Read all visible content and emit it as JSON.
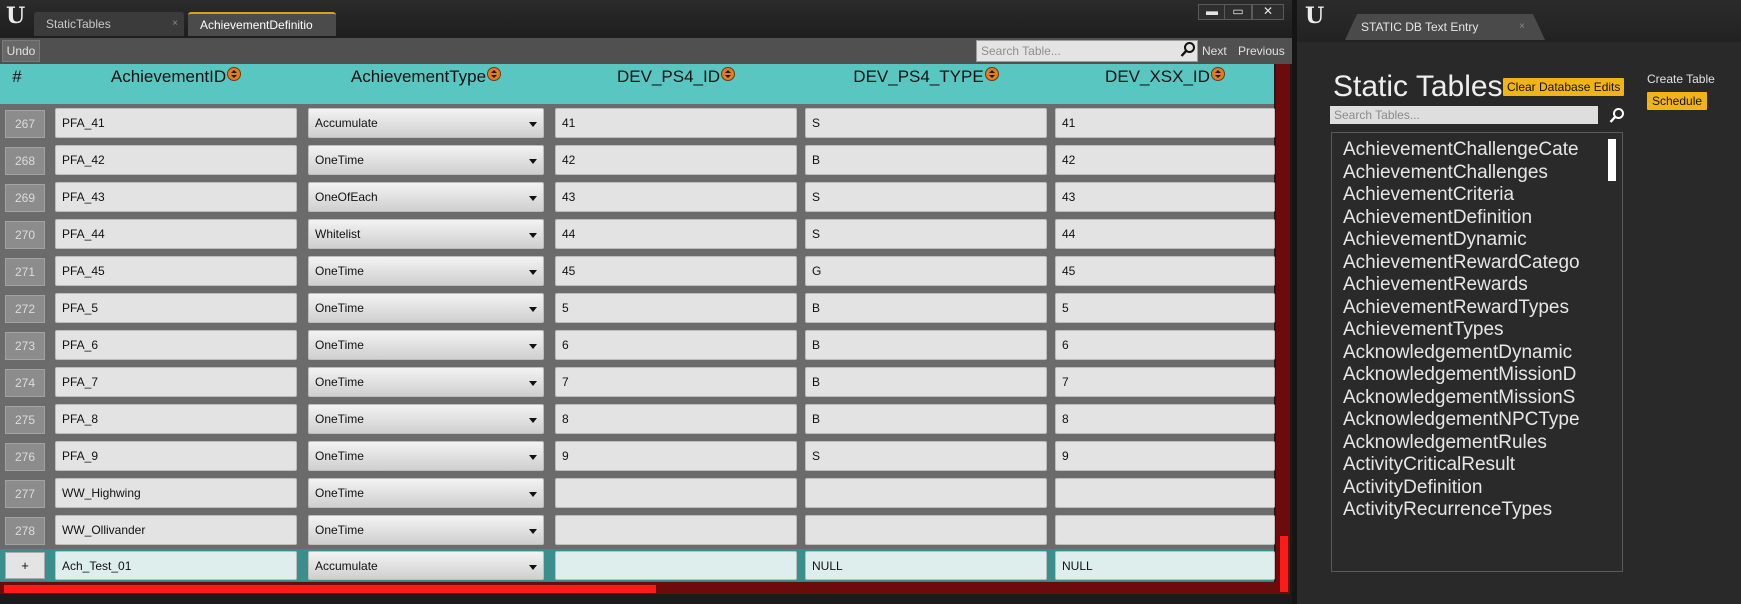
{
  "left_window": {
    "tabs": [
      {
        "label": "StaticTables",
        "close": "×"
      },
      {
        "label": "AchievementDefinitio",
        "close": ""
      }
    ],
    "window_controls": {
      "minimize": "▬",
      "maximize": "▭",
      "close": "✕"
    },
    "toolbar": {
      "undo_label": "Undo",
      "search_placeholder": "Search Table...",
      "next_label": "Next",
      "previous_label": "Previous"
    },
    "table": {
      "columns": [
        "#",
        "AchievementID",
        "AchievementType",
        "DEV_PS4_ID",
        "DEV_PS4_TYPE",
        "DEV_XSX_ID"
      ],
      "rows": [
        {
          "num": "267",
          "id": "PFA_41",
          "type": "Accumulate",
          "ps4_id": "41",
          "ps4_type": "S",
          "xsx_id": "41"
        },
        {
          "num": "268",
          "id": "PFA_42",
          "type": "OneTime",
          "ps4_id": "42",
          "ps4_type": "B",
          "xsx_id": "42"
        },
        {
          "num": "269",
          "id": "PFA_43",
          "type": "OneOfEach",
          "ps4_id": "43",
          "ps4_type": "S",
          "xsx_id": "43"
        },
        {
          "num": "270",
          "id": "PFA_44",
          "type": "Whitelist",
          "ps4_id": "44",
          "ps4_type": "S",
          "xsx_id": "44"
        },
        {
          "num": "271",
          "id": "PFA_45",
          "type": "OneTime",
          "ps4_id": "45",
          "ps4_type": "G",
          "xsx_id": "45"
        },
        {
          "num": "272",
          "id": "PFA_5",
          "type": "OneTime",
          "ps4_id": "5",
          "ps4_type": "B",
          "xsx_id": "5"
        },
        {
          "num": "273",
          "id": "PFA_6",
          "type": "OneTime",
          "ps4_id": "6",
          "ps4_type": "B",
          "xsx_id": "6"
        },
        {
          "num": "274",
          "id": "PFA_7",
          "type": "OneTime",
          "ps4_id": "7",
          "ps4_type": "B",
          "xsx_id": "7"
        },
        {
          "num": "275",
          "id": "PFA_8",
          "type": "OneTime",
          "ps4_id": "8",
          "ps4_type": "B",
          "xsx_id": "8"
        },
        {
          "num": "276",
          "id": "PFA_9",
          "type": "OneTime",
          "ps4_id": "9",
          "ps4_type": "S",
          "xsx_id": "9"
        },
        {
          "num": "277",
          "id": "WW_Highwing",
          "type": "OneTime",
          "ps4_id": "",
          "ps4_type": "",
          "xsx_id": ""
        },
        {
          "num": "278",
          "id": "WW_Ollivander",
          "type": "OneTime",
          "ps4_id": "",
          "ps4_type": "",
          "xsx_id": ""
        }
      ],
      "new_row": {
        "add_label": "+",
        "id": "Ach_Test_01",
        "type": "Accumulate",
        "ps4_id": "",
        "ps4_type": "NULL",
        "xsx_id": "NULL"
      }
    },
    "colors": {
      "header": "#59c6c1",
      "scrollbar": "#ff1a1a",
      "new_row": "#3a8f8d"
    }
  },
  "right_window": {
    "tab_label": "STATIC DB Text Entry",
    "tab_close": "×",
    "title": "Static Tables",
    "clear_edits_label": "Clear Database Edits",
    "create_table_label": "Create Table",
    "schedule_label": "Schedule",
    "search_placeholder": "Search Tables...",
    "tables": [
      "AchievementChallengeCate",
      "AchievementChallenges",
      "AchievementCriteria",
      "AchievementDefinition",
      "AchievementDynamic",
      "AchievementRewardCatego",
      "AchievementRewards",
      "AchievementRewardTypes",
      "AchievementTypes",
      "AcknowledgementDynamic",
      "AcknowledgementMissionD",
      "AcknowledgementMissionS",
      "AcknowledgementNPCType",
      "AcknowledgementRules",
      "ActivityCriticalResult",
      "ActivityDefinition",
      "ActivityRecurrenceTypes"
    ],
    "colors": {
      "accent": "#f1b418"
    }
  },
  "icons": {
    "logo": "unreal-logo-icon",
    "search": "search-icon",
    "dropdown": "chevron-down-icon",
    "sort": "sort-icon"
  }
}
